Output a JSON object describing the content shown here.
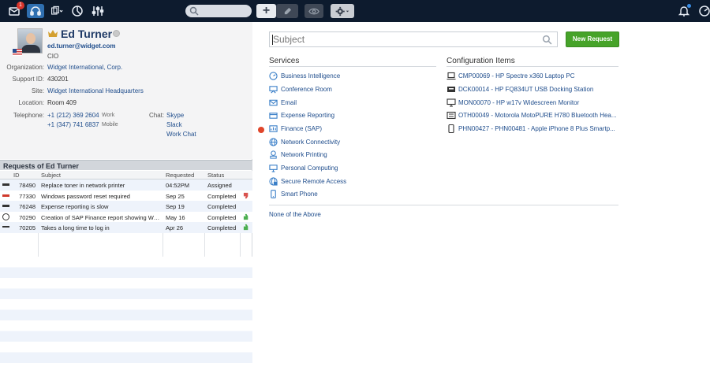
{
  "topbar": {
    "inbox_badge": "1",
    "search_placeholder": "",
    "plus": "+"
  },
  "profile": {
    "name": "Ed Turner",
    "email": "ed.turner@widget.com",
    "role": "CIO",
    "organization_label": "Organization:",
    "organization": "Widget International, Corp.",
    "support_id_label": "Support ID:",
    "support_id": "430201",
    "site_label": "Site:",
    "site": "Widget International Headquarters",
    "location_label": "Location:",
    "location": "Room 409",
    "telephone_label": "Telephone:",
    "phones": [
      {
        "number": "+1 (212) 369 2604",
        "type": "Work"
      },
      {
        "number": "+1 (347) 741 6837",
        "type": "Mobile"
      }
    ],
    "chat_label": "Chat:",
    "chats": [
      "Skype",
      "Slack",
      "Work Chat"
    ]
  },
  "requests": {
    "title": "Requests of Ed Turner",
    "columns": [
      "ID",
      "Subject",
      "Requested",
      "Status"
    ],
    "rows": [
      {
        "priority": "normal",
        "id": "78490",
        "subject": "Replace toner in network printer",
        "requested": "04:52PM",
        "status": "Assigned",
        "feedback": ""
      },
      {
        "priority": "high",
        "id": "77330",
        "subject": "Windows password reset required",
        "requested": "Sep 25",
        "status": "Completed",
        "feedback": "negative"
      },
      {
        "priority": "normal",
        "id": "76248",
        "subject": "Expense reporting is slow",
        "requested": "Sep 19",
        "status": "Completed",
        "feedback": ""
      },
      {
        "priority": "blocked",
        "id": "70290",
        "subject": "Creation of SAP Finance report showing We...",
        "requested": "May 16",
        "status": "Completed",
        "feedback": "positive"
      },
      {
        "priority": "low",
        "id": "70205",
        "subject": "Takes a long time to log in",
        "requested": "Apr 26",
        "status": "Completed",
        "feedback": "positive"
      }
    ]
  },
  "request_form": {
    "subject_placeholder": "Subject",
    "new_request_label": "New Request"
  },
  "services": {
    "title": "Services",
    "items": [
      {
        "label": "Business Intelligence",
        "icon": "speedometer-icon"
      },
      {
        "label": "Conference Room",
        "icon": "conference-icon"
      },
      {
        "label": "Email",
        "icon": "email-icon"
      },
      {
        "label": "Expense Reporting",
        "icon": "expense-icon"
      },
      {
        "label": "Finance (SAP)",
        "icon": "finance-icon"
      },
      {
        "label": "Network Connectivity",
        "icon": "globe-icon"
      },
      {
        "label": "Network Printing",
        "icon": "network-printer-icon"
      },
      {
        "label": "Personal Computing",
        "icon": "monitor-icon"
      },
      {
        "label": "Secure Remote Access",
        "icon": "secure-globe-icon"
      },
      {
        "label": "Smart Phone",
        "icon": "phone-icon"
      }
    ],
    "none_label": "None of the Above"
  },
  "config_items": {
    "title": "Configuration Items",
    "items": [
      {
        "label": "CMP00069 - HP Spectre x360 Laptop PC",
        "icon": "laptop-icon"
      },
      {
        "label": "DCK00014 - HP FQ834UT USB Docking Station",
        "icon": "docking-station-icon"
      },
      {
        "label": "MON00070 - HP w17v Widescreen Monitor",
        "icon": "monitor-icon"
      },
      {
        "label": "OTH00049 - Motorola MotoPURE H780 Bluetooth Hea...",
        "icon": "device-icon"
      },
      {
        "label": "PHN00427 - PHN00481 - Apple iPhone 8 Plus Smartp...",
        "icon": "phone-icon"
      }
    ]
  },
  "colors": {
    "topbar": "#0d1b2e",
    "accent_link": "#1f4d8c",
    "new_request_button": "#46a329",
    "priority_high": "#d03a2c",
    "alert_dot": "#e0452a"
  }
}
